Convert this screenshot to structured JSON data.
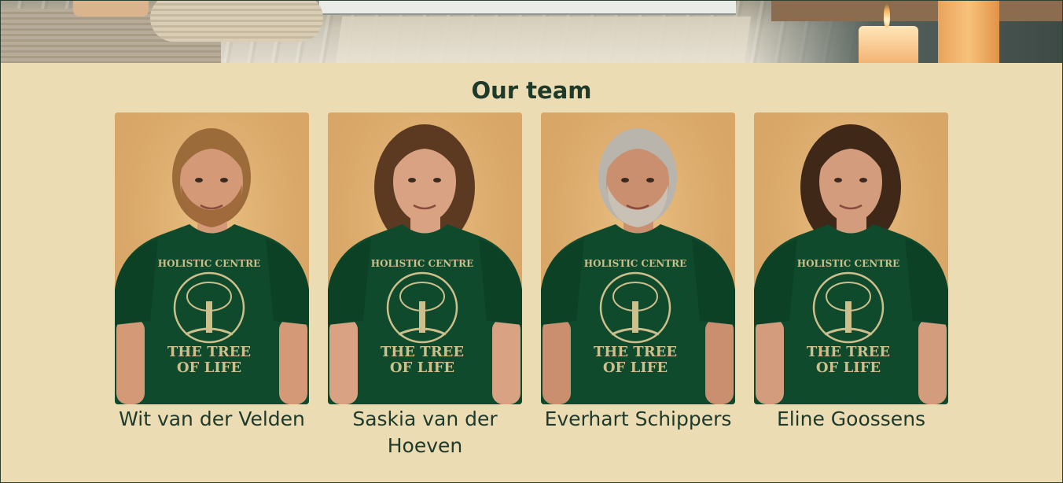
{
  "section": {
    "title": "Our team"
  },
  "team": {
    "members": [
      {
        "name": "Wit van der Velden",
        "hair": "#9c6b3a",
        "skin": "#d49a78",
        "beard": true
      },
      {
        "name": "Saskia van der Hoeven",
        "hair": "#5c3a22",
        "skin": "#d9a383",
        "beard": false
      },
      {
        "name": "Everhart Schippers",
        "hair": "#b9b4ac",
        "skin": "#c98f6e",
        "beard": true
      },
      {
        "name": "Eline Goossens",
        "hair": "#3f2818",
        "skin": "#d39c7d",
        "beard": false
      }
    ],
    "shirt": {
      "line1": "HOLISTIC CENTRE",
      "line2": "THE TREE",
      "line3": "OF LIFE",
      "color": "#0f4a2c",
      "print": "#cdbf8c"
    }
  },
  "colors": {
    "background": "#ecdcb3",
    "heading": "#1d3a2b"
  }
}
